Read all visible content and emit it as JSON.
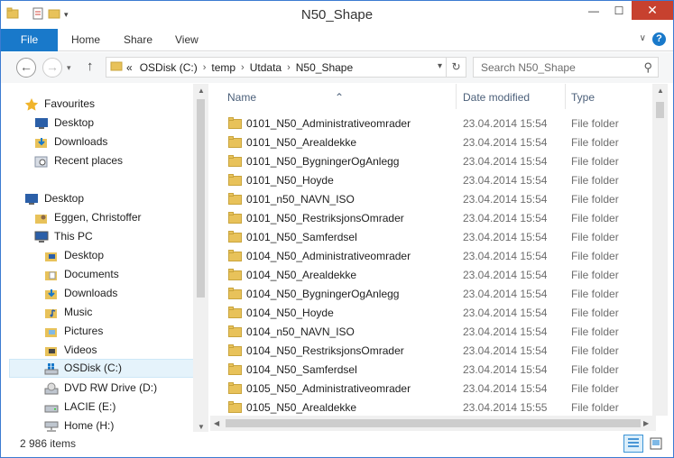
{
  "window": {
    "title": "N50_Shape",
    "minimize": "—",
    "maximize": "☐",
    "close": "✕"
  },
  "ribbon": {
    "tabs": [
      "File",
      "Home",
      "Share",
      "View"
    ],
    "help": "?",
    "expand": "∨"
  },
  "nav": {
    "back": "←",
    "forward": "→",
    "up": "↑",
    "path": [
      "«",
      "OSDisk (C:)",
      "temp",
      "Utdata",
      "N50_Shape"
    ],
    "refresh": "↻",
    "search_placeholder": "Search N50_Shape",
    "search_icon": "⚲"
  },
  "navpane": {
    "items": [
      {
        "label": "Favourites",
        "icon": "star-icon"
      },
      {
        "label": "Desktop",
        "icon": "desktop-icon"
      },
      {
        "label": "Downloads",
        "icon": "downloads-icon"
      },
      {
        "label": "Recent places",
        "icon": "recent-places-icon"
      },
      {
        "label": "Desktop",
        "icon": "desktop-icon"
      },
      {
        "label": "Eggen, Christoffer",
        "icon": "user-folder-icon"
      },
      {
        "label": "This PC",
        "icon": "this-pc-icon"
      },
      {
        "label": "Desktop",
        "icon": "folder-icon"
      },
      {
        "label": "Documents",
        "icon": "documents-icon"
      },
      {
        "label": "Downloads",
        "icon": "downloads-icon"
      },
      {
        "label": "Music",
        "icon": "music-icon"
      },
      {
        "label": "Pictures",
        "icon": "pictures-icon"
      },
      {
        "label": "Videos",
        "icon": "videos-icon"
      },
      {
        "label": "OSDisk (C:)",
        "icon": "windows-drive-icon"
      },
      {
        "label": "DVD RW Drive (D:)",
        "icon": "dvd-drive-icon"
      },
      {
        "label": "LACIE (E:)",
        "icon": "drive-icon"
      },
      {
        "label": "Home (H:)",
        "icon": "network-drive-icon"
      }
    ]
  },
  "columns": {
    "name": "Name",
    "date": "Date modified",
    "type": "Type"
  },
  "files": [
    {
      "name": "0101_N50_Administrativeomrader",
      "date": "23.04.2014 15:54",
      "type": "File folder"
    },
    {
      "name": "0101_N50_Arealdekke",
      "date": "23.04.2014 15:54",
      "type": "File folder"
    },
    {
      "name": "0101_N50_BygningerOgAnlegg",
      "date": "23.04.2014 15:54",
      "type": "File folder"
    },
    {
      "name": "0101_N50_Hoyde",
      "date": "23.04.2014 15:54",
      "type": "File folder"
    },
    {
      "name": "0101_n50_NAVN_ISO",
      "date": "23.04.2014 15:54",
      "type": "File folder"
    },
    {
      "name": "0101_N50_RestriksjonsOmrader",
      "date": "23.04.2014 15:54",
      "type": "File folder"
    },
    {
      "name": "0101_N50_Samferdsel",
      "date": "23.04.2014 15:54",
      "type": "File folder"
    },
    {
      "name": "0104_N50_Administrativeomrader",
      "date": "23.04.2014 15:54",
      "type": "File folder"
    },
    {
      "name": "0104_N50_Arealdekke",
      "date": "23.04.2014 15:54",
      "type": "File folder"
    },
    {
      "name": "0104_N50_BygningerOgAnlegg",
      "date": "23.04.2014 15:54",
      "type": "File folder"
    },
    {
      "name": "0104_N50_Hoyde",
      "date": "23.04.2014 15:54",
      "type": "File folder"
    },
    {
      "name": "0104_n50_NAVN_ISO",
      "date": "23.04.2014 15:54",
      "type": "File folder"
    },
    {
      "name": "0104_N50_RestriksjonsOmrader",
      "date": "23.04.2014 15:54",
      "type": "File folder"
    },
    {
      "name": "0104_N50_Samferdsel",
      "date": "23.04.2014 15:54",
      "type": "File folder"
    },
    {
      "name": "0105_N50_Administrativeomrader",
      "date": "23.04.2014 15:54",
      "type": "File folder"
    },
    {
      "name": "0105_N50_Arealdekke",
      "date": "23.04.2014 15:55",
      "type": "File folder"
    }
  ],
  "status": {
    "count": "2 986 items"
  },
  "colors": {
    "accent": "#1979ca",
    "folder": "#e8c25a",
    "close": "#c7412f"
  }
}
